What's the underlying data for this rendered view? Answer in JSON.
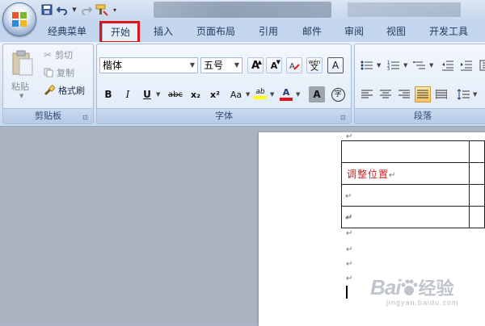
{
  "tabs": [
    {
      "label": "经典菜单"
    },
    {
      "label": "开始"
    },
    {
      "label": "插入"
    },
    {
      "label": "页面布局"
    },
    {
      "label": "引用"
    },
    {
      "label": "邮件"
    },
    {
      "label": "审阅"
    },
    {
      "label": "视图"
    },
    {
      "label": "开发工具"
    }
  ],
  "active_tab": "开始",
  "clipboard": {
    "paste_label": "粘贴",
    "cut_label": "剪切",
    "copy_label": "复制",
    "format_painter_label": "格式刷",
    "group_label": "剪贴板"
  },
  "font": {
    "font_name": "楷体",
    "font_size": "五号",
    "grow_label": "A",
    "shrink_label": "A",
    "phonetic_label": "文",
    "phonetic_top": "wén",
    "border_label": "A",
    "bold_label": "B",
    "italic_label": "I",
    "underline_label": "U",
    "strike_label": "abc",
    "sub_label": "x₂",
    "sup_label": "x²",
    "case_label": "Aa",
    "highlight_label": "ab",
    "color_label": "A",
    "shade_label": "A",
    "enclose_label": "字",
    "group_label": "字体"
  },
  "paragraph": {
    "group_label": "段落"
  },
  "document": {
    "cell_text": "调整位置",
    "para_mark": "↵"
  },
  "watermark": {
    "brand": "Bai",
    "brand_cn": "经验",
    "url": "jingyan.baidu.com"
  },
  "colors": {
    "highlight_box": "#e0121a",
    "accent_text": "#d21c1c",
    "font_color_bar": "#e0121a",
    "highlight_color_bar": "#ffff00"
  }
}
